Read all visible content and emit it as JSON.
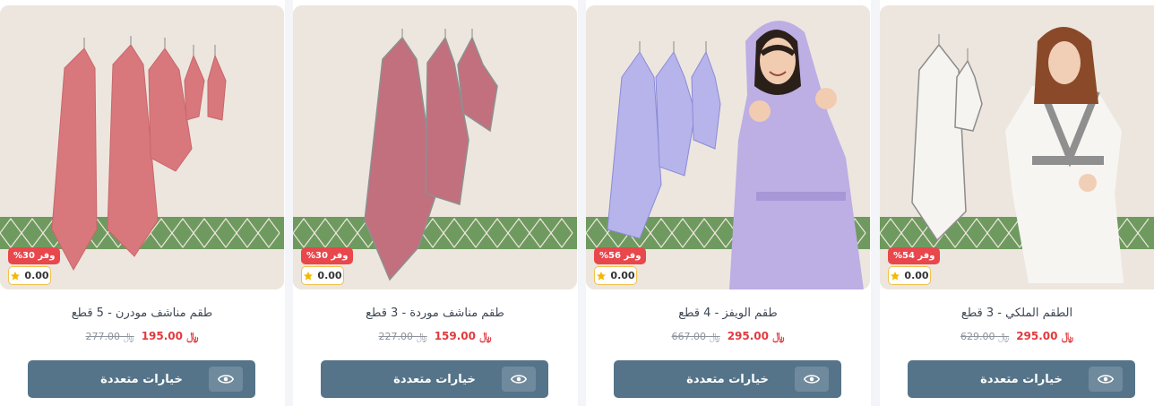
{
  "products": [
    {
      "title": "طقم مناشف مودرن - 5 قطع",
      "price": "195.00",
      "old_price": "277.00",
      "currency": "﷼",
      "discount": "وفر 30%",
      "rating": "0.00",
      "button_label": "خيارات متعددة"
    },
    {
      "title": "طقم مناشف موردة - 3 قطع",
      "price": "159.00",
      "old_price": "227.00",
      "currency": "﷼",
      "discount": "وفر 30%",
      "rating": "0.00",
      "button_label": "خيارات متعددة"
    },
    {
      "title": "طقم الويفز - 4 قطع",
      "price": "295.00",
      "old_price": "667.00",
      "currency": "﷼",
      "discount": "وفر 56%",
      "rating": "0.00",
      "button_label": "خيارات متعددة"
    },
    {
      "title": "الطقم الملكي - 3 قطع",
      "price": "295.00",
      "old_price": "629.00",
      "currency": "﷼",
      "discount": "وفر 54%",
      "rating": "0.00",
      "button_label": "خيارات متعددة"
    }
  ],
  "colors": {
    "badge": "#e8474c",
    "price": "#e23a3f",
    "button": "#557489",
    "star": "#f5b800"
  },
  "icons": {
    "rating": "star-icon",
    "quick_view": "eye-icon"
  }
}
